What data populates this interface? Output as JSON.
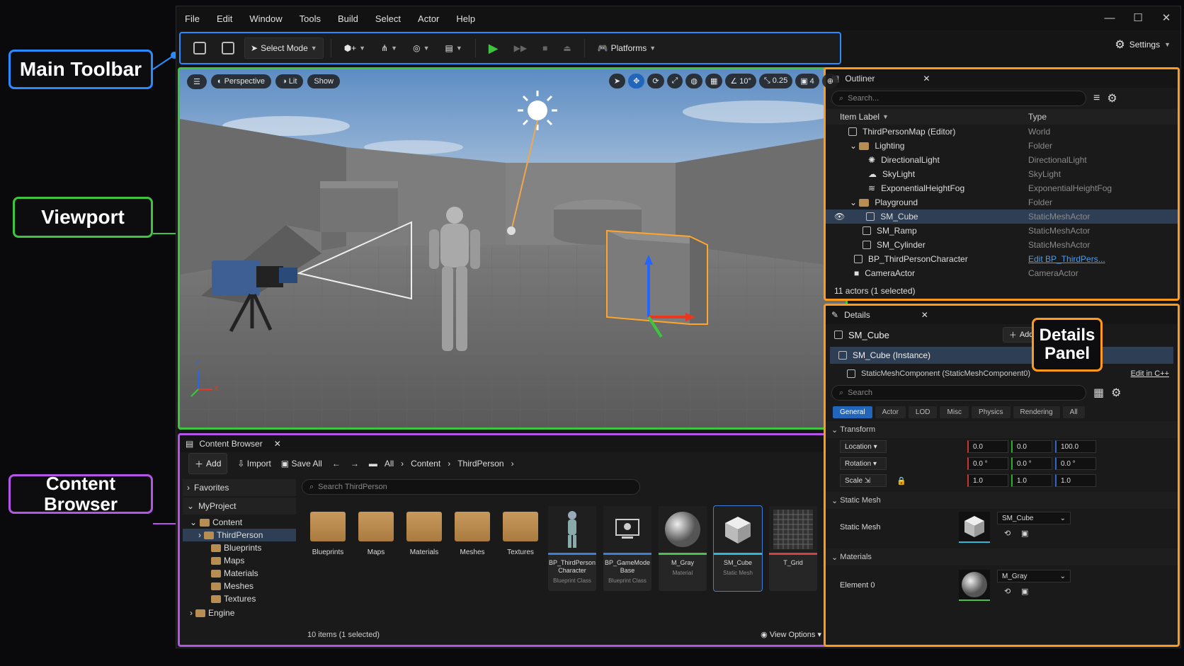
{
  "callouts": {
    "main_toolbar": "Main Toolbar",
    "viewport": "Viewport",
    "content_browser": "Content Browser",
    "details_line1": "Details",
    "details_line2": "Panel"
  },
  "menu": [
    "File",
    "Edit",
    "Window",
    "Tools",
    "Build",
    "Select",
    "Actor",
    "Help"
  ],
  "window_controls": [
    "—",
    "☐",
    "✕"
  ],
  "toolbar": {
    "select_mode": "Select Mode",
    "platforms": "Platforms",
    "settings": "Settings"
  },
  "viewport": {
    "perspective": "Perspective",
    "lit": "Lit",
    "show": "Show",
    "angle": "10°",
    "scale": "0.25",
    "camera_speed": "4",
    "axis_z": "Z",
    "axis_x": "X"
  },
  "outliner": {
    "title": "Outliner",
    "search_placeholder": "Search...",
    "col_label": "Item Label",
    "col_type": "Type",
    "rows": [
      {
        "label": "ThirdPersonMap (Editor)",
        "type": "World",
        "indent": 0
      },
      {
        "label": "Lighting",
        "type": "Folder",
        "indent": 1
      },
      {
        "label": "DirectionalLight",
        "type": "DirectionalLight",
        "indent": 2
      },
      {
        "label": "SkyLight",
        "type": "SkyLight",
        "indent": 2
      },
      {
        "label": "ExponentialHeightFog",
        "type": "ExponentialHeightFog",
        "indent": 2
      },
      {
        "label": "Playground",
        "type": "Folder",
        "indent": 1
      },
      {
        "label": "SM_Cube",
        "type": "StaticMeshActor",
        "indent": 2,
        "selected": true
      },
      {
        "label": "SM_Ramp",
        "type": "StaticMeshActor",
        "indent": 2
      },
      {
        "label": "SM_Cylinder",
        "type": "StaticMeshActor",
        "indent": 2
      },
      {
        "label": "BP_ThirdPersonCharacter",
        "type": "Edit BP_ThirdPers...",
        "indent": 1,
        "link": true
      },
      {
        "label": "CameraActor",
        "type": "CameraActor",
        "indent": 1
      }
    ],
    "footer": "11 actors (1 selected)"
  },
  "details": {
    "title": "Details",
    "object": "SM_Cube",
    "add": "Add",
    "instance": "SM_Cube (Instance)",
    "component": "StaticMeshComponent (StaticMeshComponent0)",
    "edit_cpp": "Edit in C++",
    "search_placeholder": "Search",
    "categories": [
      "General",
      "Actor",
      "LOD",
      "Misc",
      "Physics",
      "Rendering",
      "All"
    ],
    "transform_title": "Transform",
    "location_label": "Location",
    "location": [
      "0.0",
      "0.0",
      "100.0"
    ],
    "rotation_label": "Rotation",
    "rotation": [
      "0.0 °",
      "0.0 °",
      "0.0 °"
    ],
    "scale_label": "Scale",
    "scale": [
      "1.0",
      "1.0",
      "1.0"
    ],
    "static_mesh_title": "Static Mesh",
    "static_mesh_label": "Static Mesh",
    "static_mesh_value": "SM_Cube",
    "materials_title": "Materials",
    "element0_label": "Element 0",
    "element0_value": "M_Gray"
  },
  "content_browser": {
    "title": "Content Browser",
    "add": "Add",
    "import": "Import",
    "save_all": "Save All",
    "breadcrumb": [
      "All",
      "Content",
      "ThirdPerson"
    ],
    "favorites": "Favorites",
    "project": "MyProject",
    "tree": [
      {
        "label": "Content",
        "indent": 1
      },
      {
        "label": "ThirdPerson",
        "indent": 2,
        "selected": true
      },
      {
        "label": "Blueprints",
        "indent": 3
      },
      {
        "label": "Maps",
        "indent": 3
      },
      {
        "label": "Materials",
        "indent": 3
      },
      {
        "label": "Meshes",
        "indent": 3
      },
      {
        "label": "Textures",
        "indent": 3
      },
      {
        "label": "Engine",
        "indent": 0
      }
    ],
    "search_placeholder": "Search ThirdPerson",
    "folders": [
      "Blueprints",
      "Maps",
      "Materials",
      "Meshes",
      "Textures"
    ],
    "assets": [
      {
        "name": "BP_ThirdPerson Character",
        "sub": "Blueprint Class",
        "color": "#3b7fd6"
      },
      {
        "name": "BP_GameMode Base",
        "sub": "Blueprint Class",
        "color": "#3b7fd6"
      },
      {
        "name": "M_Gray",
        "sub": "Material",
        "color": "#4ec04e"
      },
      {
        "name": "SM_Cube",
        "sub": "Static Mesh",
        "color": "#2fb8d6"
      },
      {
        "name": "T_Grid",
        "sub": "",
        "color": "#d84040"
      }
    ],
    "status": "10 items (1 selected)",
    "view_options": "View Options"
  }
}
